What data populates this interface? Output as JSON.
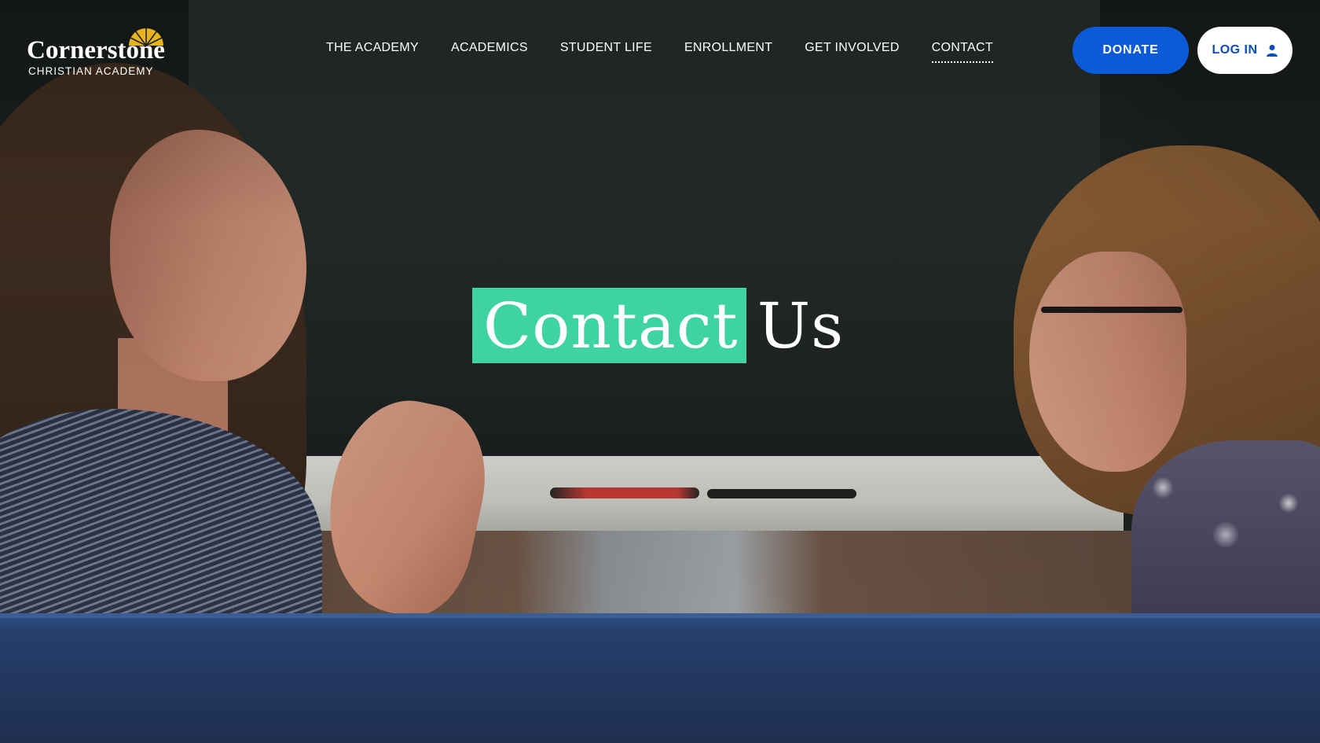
{
  "logo": {
    "name": "Cornerstone",
    "subtitle": "CHRISTIAN ACADEMY",
    "sun_color": "#e8b21f"
  },
  "nav": {
    "items": [
      {
        "label": "THE ACADEMY",
        "active": false
      },
      {
        "label": "ACADEMICS",
        "active": false
      },
      {
        "label": "STUDENT LIFE",
        "active": false
      },
      {
        "label": "ENROLLMENT",
        "active": false
      },
      {
        "label": "GET INVOLVED",
        "active": false
      },
      {
        "label": "CONTACT",
        "active": true
      }
    ]
  },
  "actions": {
    "donate_label": "DONATE",
    "login_label": "LOG IN",
    "donate_color": "#0b5ad8"
  },
  "hero": {
    "title_highlight": "Contact",
    "title_rest": "Us",
    "highlight_color": "#3fd3a4"
  },
  "icons": {
    "login": "user-icon",
    "logo_mark": "sun-icon"
  }
}
